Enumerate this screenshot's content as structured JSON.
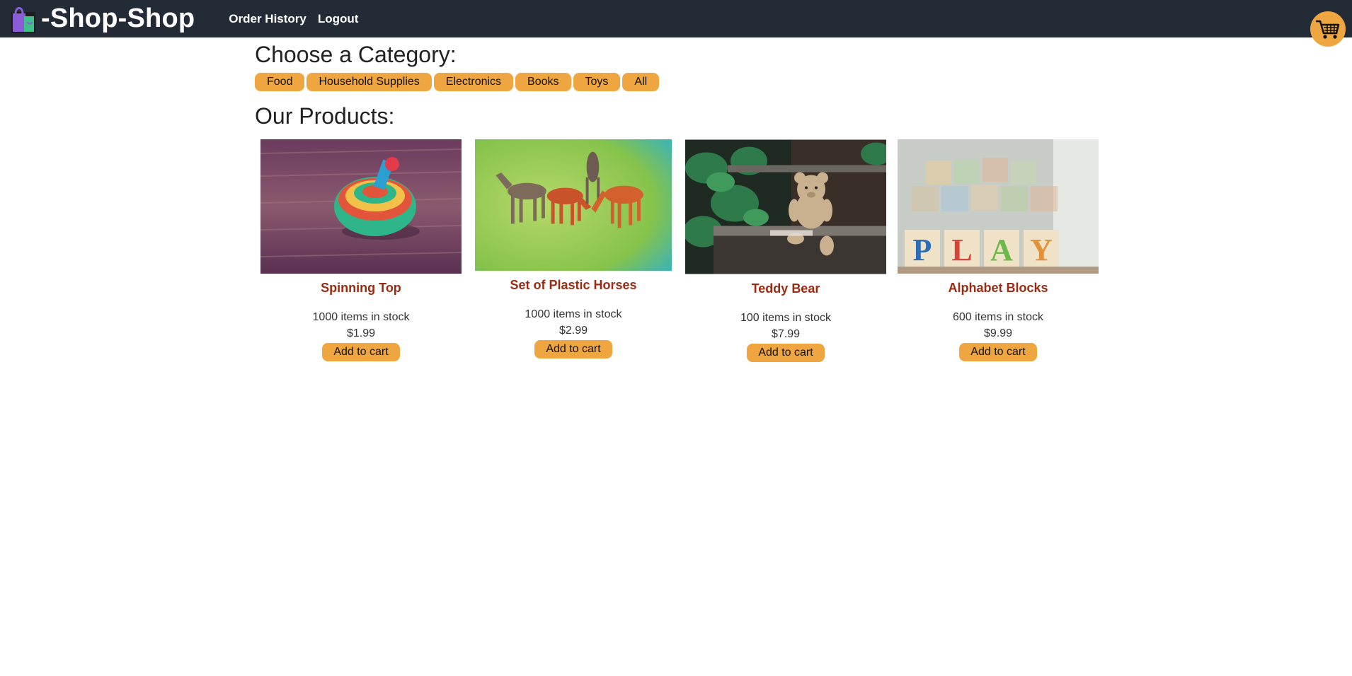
{
  "nav": {
    "brand": "-Shop-Shop",
    "links": [
      "Order History",
      "Logout"
    ]
  },
  "categories": {
    "title": "Choose a Category:",
    "items": [
      "Food",
      "Household Supplies",
      "Electronics",
      "Books",
      "Toys",
      "All"
    ]
  },
  "products": {
    "title": "Our Products:",
    "items": [
      {
        "name": "Spinning Top",
        "stock": "1000 items in stock",
        "price": "$1.99",
        "button": "Add to cart",
        "image": "spinning-top"
      },
      {
        "name": "Set of Plastic Horses",
        "stock": "1000 items in stock",
        "price": "$2.99",
        "button": "Add to cart",
        "image": "plastic-horses"
      },
      {
        "name": "Teddy Bear",
        "stock": "100 items in stock",
        "price": "$7.99",
        "button": "Add to cart",
        "image": "teddy-bear"
      },
      {
        "name": "Alphabet Blocks",
        "stock": "600 items in stock",
        "price": "$9.99",
        "button": "Add to cart",
        "image": "alphabet-blocks",
        "image_letters": [
          "P",
          "L",
          "A",
          "Y"
        ]
      }
    ]
  },
  "icons": {
    "logo": "shopping-bag-icon",
    "cart": "shopping-cart-icon"
  },
  "colors": {
    "navbar": "#232b37",
    "accent": "#f0a640",
    "product_name": "#9a2a12"
  }
}
